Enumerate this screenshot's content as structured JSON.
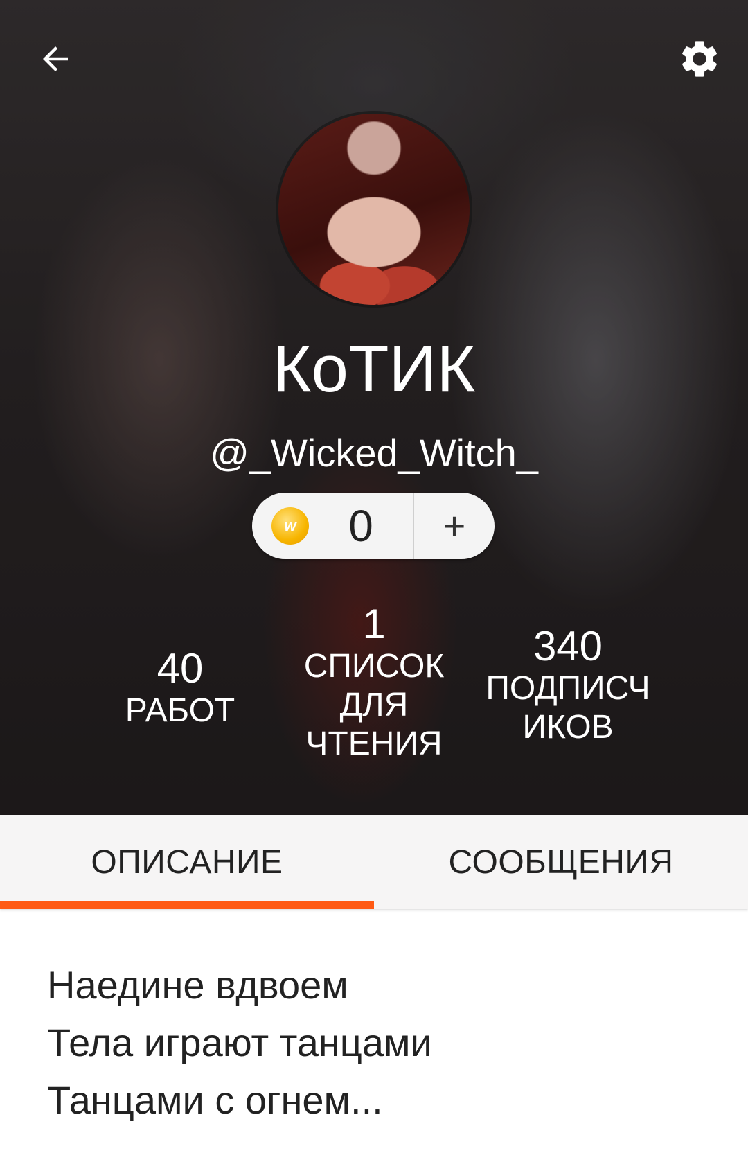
{
  "profile": {
    "display_name": "КоТИК",
    "username": "@_Wicked_Witch_"
  },
  "coins": {
    "icon": "coin-w-icon",
    "value": "0",
    "add_label": "+"
  },
  "stats": {
    "works": {
      "value": "40",
      "label": "РАБОТ"
    },
    "reading_lists": {
      "value": "1",
      "label": [
        "СПИСОК",
        "ДЛЯ",
        "ЧТЕНИЯ"
      ]
    },
    "followers": {
      "value": "340",
      "label": [
        "ПОДПИСЧ",
        "ИКОВ"
      ]
    }
  },
  "tabs": [
    {
      "label": "ОПИСАНИЕ",
      "active": true
    },
    {
      "label": "СООБЩЕНИЯ",
      "active": false
    }
  ],
  "description": [
    "Наедине вдвоем",
    "Тела играют танцами",
    "Танцами с огнем..."
  ],
  "colors": {
    "accent": "#ff5a14",
    "coin": "#f7b500"
  },
  "icons": {
    "back": "arrow-left-icon",
    "settings": "gear-icon"
  }
}
